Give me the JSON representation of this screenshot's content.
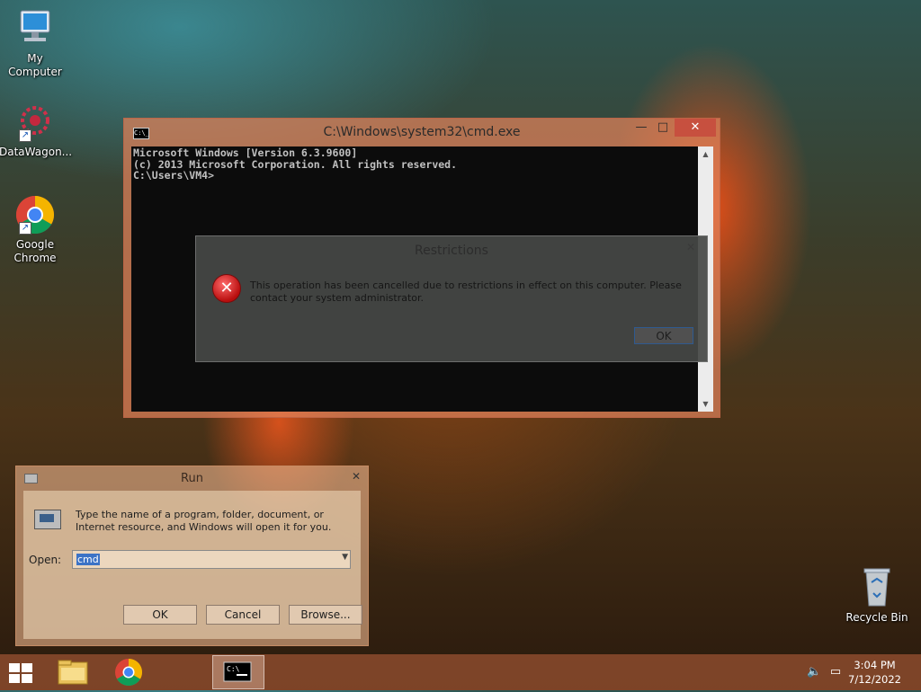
{
  "desktop_icons": [
    {
      "label": "My Computer",
      "icon": "computer-icon"
    },
    {
      "label": "DataWagon...",
      "icon": "datawagon-icon"
    },
    {
      "label": "Google Chrome",
      "icon": "chrome-icon"
    },
    {
      "label": "Recycle Bin",
      "icon": "recycle-bin-icon"
    }
  ],
  "cmd_window": {
    "title": "C:\\Windows\\system32\\cmd.exe",
    "icon_text": "C:\\_",
    "lines": [
      "Microsoft Windows [Version 6.3.9600]",
      "(c) 2013 Microsoft Corporation. All rights reserved.",
      "",
      "C:\\Users\\VM4>"
    ],
    "minimize": "—",
    "maximize": "□",
    "close": "✕"
  },
  "restrictions_dialog": {
    "title": "Restrictions",
    "message": "This operation has been cancelled due to restrictions in effect on this computer. Please contact your system administrator.",
    "ok_label": "OK",
    "close": "✕"
  },
  "run_dialog": {
    "title": "Run",
    "close": "✕",
    "description": "Type the name of a program, folder, document, or Internet resource, and Windows will open it for you.",
    "open_label": "Open:",
    "open_value": "cmd",
    "ok_label": "OK",
    "cancel_label": "Cancel",
    "browse_label": "Browse..."
  },
  "taskbar": {
    "pinned": [
      "file-explorer-icon",
      "chrome-icon",
      "cmd-icon"
    ],
    "time": "3:04 PM",
    "date": "7/12/2022",
    "tray": [
      "volume-muted-icon",
      "network-icon"
    ]
  }
}
